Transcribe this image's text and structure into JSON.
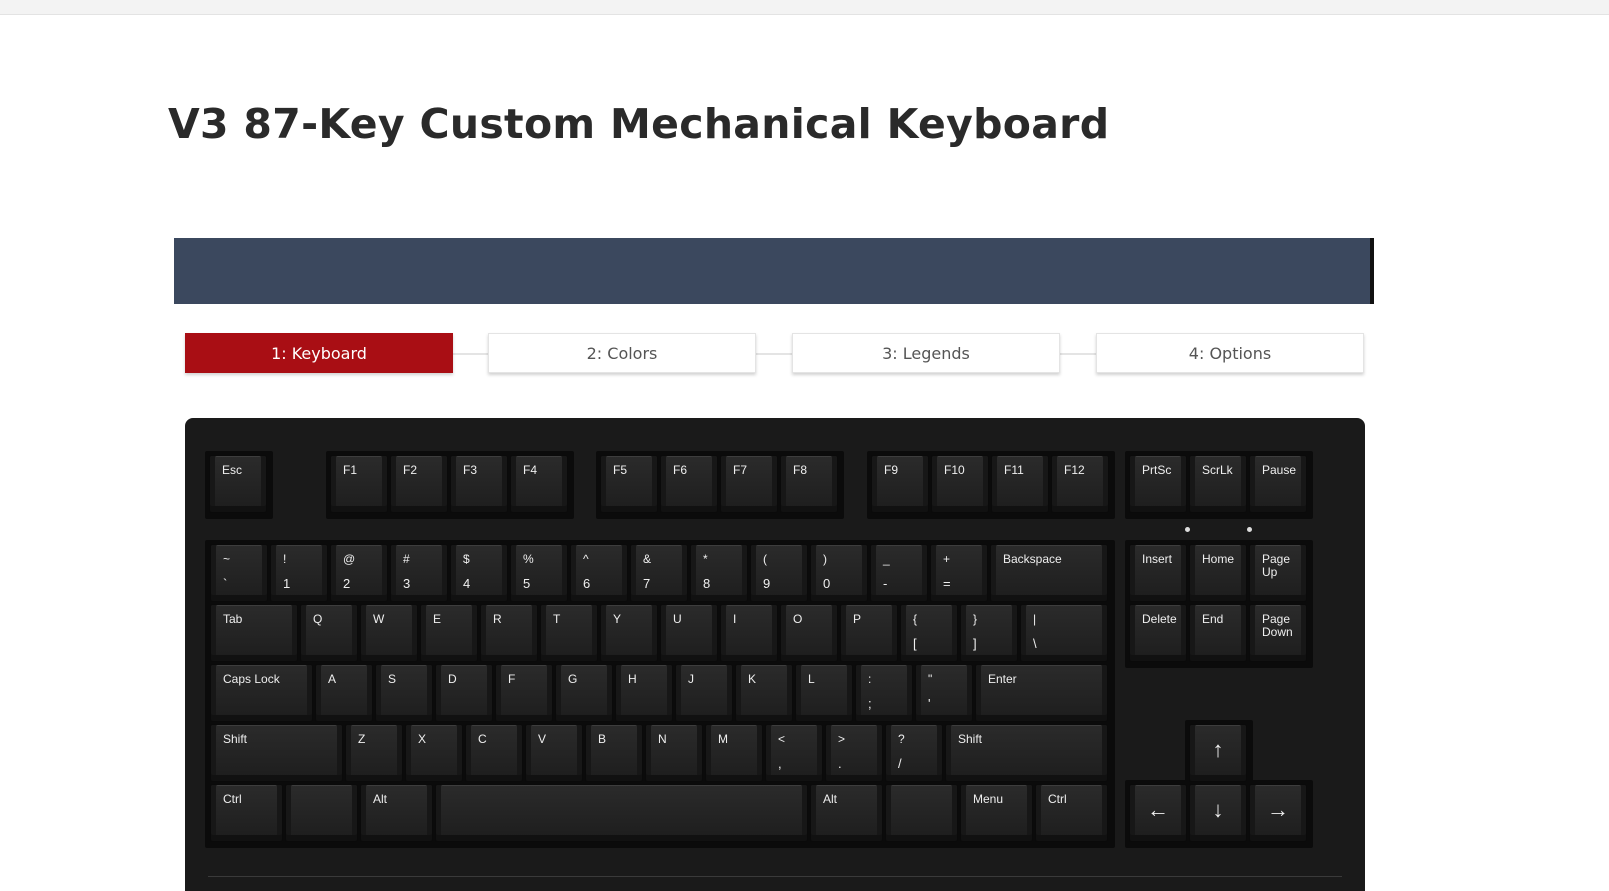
{
  "page": {
    "title": "V3 87-Key Custom Mechanical Keyboard"
  },
  "steps": [
    {
      "label": "1: Keyboard",
      "active": true
    },
    {
      "label": "2: Colors",
      "active": false
    },
    {
      "label": "3: Legends",
      "active": false
    },
    {
      "label": "4: Options",
      "active": false
    }
  ],
  "colors": {
    "banner": "#3b485e",
    "active_step": "#a90e14",
    "keyboard_case": "#1a1a1a",
    "keycap": "#222222",
    "legend": "#efefef"
  },
  "keyboard": {
    "f_row": [
      {
        "id": "esc",
        "top": "Esc"
      },
      {
        "id": "f1",
        "top": "F1"
      },
      {
        "id": "f2",
        "top": "F2"
      },
      {
        "id": "f3",
        "top": "F3"
      },
      {
        "id": "f4",
        "top": "F4"
      },
      {
        "id": "f5",
        "top": "F5"
      },
      {
        "id": "f6",
        "top": "F6"
      },
      {
        "id": "f7",
        "top": "F7"
      },
      {
        "id": "f8",
        "top": "F8"
      },
      {
        "id": "f9",
        "top": "F9"
      },
      {
        "id": "f10",
        "top": "F10"
      },
      {
        "id": "f11",
        "top": "F11"
      },
      {
        "id": "f12",
        "top": "F12"
      },
      {
        "id": "prtsc",
        "top": "PrtSc"
      },
      {
        "id": "scrlk",
        "top": "ScrLk"
      },
      {
        "id": "pause",
        "top": "Pause"
      }
    ],
    "number_row": [
      {
        "id": "tilde",
        "top": "~",
        "bottom": "`"
      },
      {
        "id": "1",
        "top": "!",
        "bottom": "1"
      },
      {
        "id": "2",
        "top": "@",
        "bottom": "2"
      },
      {
        "id": "3",
        "top": "#",
        "bottom": "3"
      },
      {
        "id": "4",
        "top": "$",
        "bottom": "4"
      },
      {
        "id": "5",
        "top": "%",
        "bottom": "5"
      },
      {
        "id": "6",
        "top": "^",
        "bottom": "6"
      },
      {
        "id": "7",
        "top": "&",
        "bottom": "7"
      },
      {
        "id": "8",
        "top": "*",
        "bottom": "8"
      },
      {
        "id": "9",
        "top": "(",
        "bottom": "9"
      },
      {
        "id": "0",
        "top": ")",
        "bottom": "0"
      },
      {
        "id": "minus",
        "top": "_",
        "bottom": "-"
      },
      {
        "id": "equals",
        "top": "+",
        "bottom": "="
      },
      {
        "id": "backspace",
        "top": "Backspace"
      }
    ],
    "tab_row": [
      {
        "id": "tab",
        "top": "Tab"
      },
      {
        "id": "q",
        "top": "Q"
      },
      {
        "id": "w",
        "top": "W"
      },
      {
        "id": "e",
        "top": "E"
      },
      {
        "id": "r",
        "top": "R"
      },
      {
        "id": "t",
        "top": "T"
      },
      {
        "id": "y",
        "top": "Y"
      },
      {
        "id": "u",
        "top": "U"
      },
      {
        "id": "i",
        "top": "I"
      },
      {
        "id": "o",
        "top": "O"
      },
      {
        "id": "p",
        "top": "P"
      },
      {
        "id": "lbracket",
        "top": "{",
        "bottom": "["
      },
      {
        "id": "rbracket",
        "top": "}",
        "bottom": "]"
      },
      {
        "id": "backslash",
        "top": "|",
        "bottom": "\\"
      }
    ],
    "caps_row": [
      {
        "id": "capslock",
        "top": "Caps Lock"
      },
      {
        "id": "a",
        "top": "A"
      },
      {
        "id": "s",
        "top": "S"
      },
      {
        "id": "d",
        "top": "D"
      },
      {
        "id": "f",
        "top": "F"
      },
      {
        "id": "g",
        "top": "G"
      },
      {
        "id": "h",
        "top": "H"
      },
      {
        "id": "j",
        "top": "J"
      },
      {
        "id": "k",
        "top": "K"
      },
      {
        "id": "l",
        "top": "L"
      },
      {
        "id": "semicolon",
        "top": ":",
        "bottom": ";"
      },
      {
        "id": "quote",
        "top": "\"",
        "bottom": "'"
      },
      {
        "id": "enter",
        "top": "Enter"
      }
    ],
    "shift_row": [
      {
        "id": "lshift",
        "top": "Shift"
      },
      {
        "id": "z",
        "top": "Z"
      },
      {
        "id": "x",
        "top": "X"
      },
      {
        "id": "c",
        "top": "C"
      },
      {
        "id": "v",
        "top": "V"
      },
      {
        "id": "b",
        "top": "B"
      },
      {
        "id": "n",
        "top": "N"
      },
      {
        "id": "m",
        "top": "M"
      },
      {
        "id": "comma",
        "top": "<",
        "bottom": ","
      },
      {
        "id": "period",
        "top": ">",
        "bottom": "."
      },
      {
        "id": "slash",
        "top": "?",
        "bottom": "/"
      },
      {
        "id": "rshift",
        "top": "Shift"
      }
    ],
    "bottom_row": [
      {
        "id": "lctrl",
        "top": "Ctrl"
      },
      {
        "id": "lwin",
        "top": ""
      },
      {
        "id": "lalt",
        "top": "Alt"
      },
      {
        "id": "space",
        "top": ""
      },
      {
        "id": "ralt",
        "top": "Alt"
      },
      {
        "id": "rwin",
        "top": ""
      },
      {
        "id": "menu",
        "top": "Menu"
      },
      {
        "id": "rctrl",
        "top": "Ctrl"
      }
    ],
    "nav_cluster": [
      {
        "id": "insert",
        "top": "Insert"
      },
      {
        "id": "home",
        "top": "Home"
      },
      {
        "id": "pageup",
        "top": "Page\nUp"
      },
      {
        "id": "delete",
        "top": "Delete"
      },
      {
        "id": "end",
        "top": "End"
      },
      {
        "id": "pagedown",
        "top": "Page\nDown"
      }
    ],
    "arrows": [
      {
        "id": "up",
        "top": "↑"
      },
      {
        "id": "left",
        "top": "←"
      },
      {
        "id": "down",
        "top": "↓"
      },
      {
        "id": "right",
        "top": "→"
      }
    ]
  }
}
